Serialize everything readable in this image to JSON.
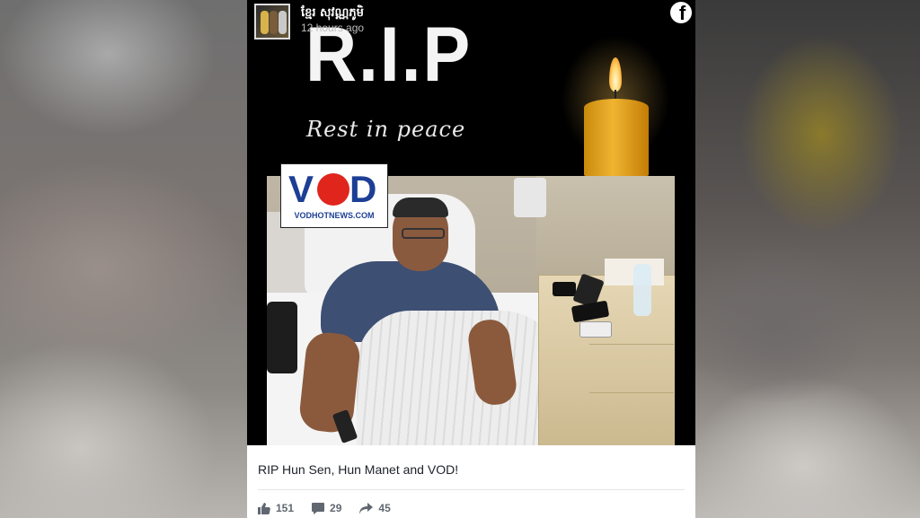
{
  "post": {
    "author": "ខ្មែរ សុវណ្ណភូមិ",
    "timestamp": "12 hours ago",
    "caption": "RIP Hun Sen, Hun Manet and VOD!",
    "image": {
      "banner_title": "R.I.P",
      "banner_subtitle": "Rest in peace",
      "logo_letters_left": "V",
      "logo_letters_right": "D",
      "logo_url": "VODHOTNEWS.COM"
    },
    "stats": {
      "likes": "151",
      "comments": "29",
      "shares": "45"
    }
  },
  "icons": {
    "platform": "facebook-icon",
    "like": "thumbs-up-icon",
    "comment": "comment-icon",
    "share": "share-icon"
  },
  "colors": {
    "vod_blue": "#1c3f95",
    "vod_red": "#e0251d",
    "candle": "#f1b431"
  }
}
